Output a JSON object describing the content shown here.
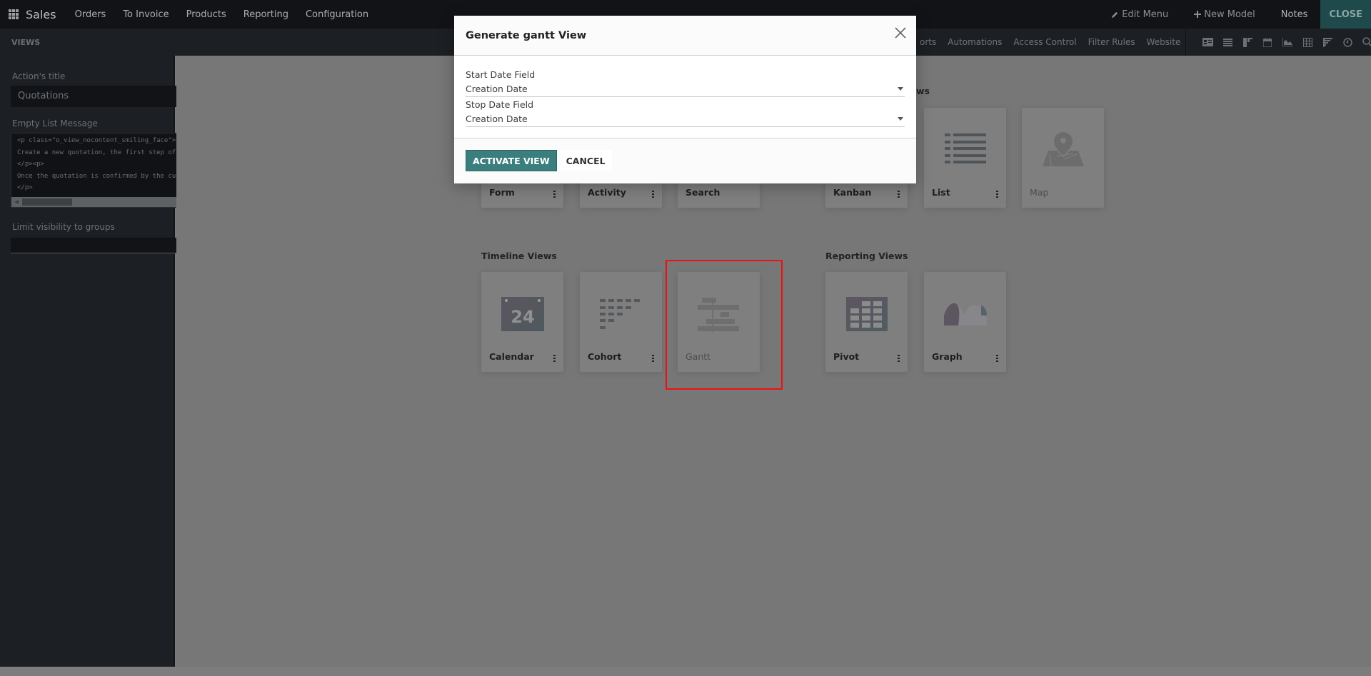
{
  "navbar": {
    "brand": "Sales",
    "menu": [
      "Orders",
      "To Invoice",
      "Products",
      "Reporting",
      "Configuration"
    ],
    "right": {
      "edit_menu": "Edit Menu",
      "new_model": "New Model",
      "notes": "Notes",
      "close": "CLOSE"
    }
  },
  "subbar": {
    "section_label": "VIEWS",
    "tabs": [
      "orts",
      "Automations",
      "Access Control",
      "Filter Rules",
      "Website"
    ],
    "view_icons": [
      "form-view-icon",
      "list-view-icon",
      "kanban-view-icon",
      "calendar-view-icon",
      "graph-view-icon",
      "pivot-view-icon",
      "gantt-view-icon",
      "activity-view-icon",
      "search-view-icon"
    ]
  },
  "sidebar": {
    "action_title_label": "Action's title",
    "action_title_value": "Quotations",
    "empty_message_label": "Empty List Message",
    "empty_message_lines": [
      "<p class=\"o_view_nocontent_smiling_face\">",
      "Create a new quotation, the first step of a",
      "</p><p>",
      "Once the quotation is confirmed by the custo",
      "</p>"
    ],
    "groups_label": "Limit visibility to groups",
    "groups_value": ""
  },
  "main": {
    "partial_section_title": "ws",
    "sections": {
      "timeline": "Timeline Views",
      "reporting": "Reporting Views"
    },
    "cards": {
      "form": {
        "name": "Form",
        "active": true
      },
      "activity": {
        "name": "Activity",
        "active": true
      },
      "search": {
        "name": "Search",
        "active": true
      },
      "kanban": {
        "name": "Kanban",
        "active": true
      },
      "list": {
        "name": "List",
        "active": true
      },
      "map": {
        "name": "Map",
        "active": false
      },
      "calendar": {
        "name": "Calendar",
        "active": true,
        "day": "24"
      },
      "cohort": {
        "name": "Cohort",
        "active": true
      },
      "gantt": {
        "name": "Gantt",
        "active": false
      },
      "pivot": {
        "name": "Pivot",
        "active": true
      },
      "graph": {
        "name": "Graph",
        "active": true
      }
    }
  },
  "modal": {
    "title": "Generate gantt View",
    "start_label": "Start Date Field",
    "start_value": "Creation Date",
    "stop_label": "Stop Date Field",
    "stop_value": "Creation Date",
    "activate_button": "ACTIVATE VIEW",
    "cancel_button": "CANCEL"
  },
  "colors": {
    "primary": "#3b7e7e",
    "highlight": "#ee1111",
    "navbar_bg": "#111317"
  }
}
